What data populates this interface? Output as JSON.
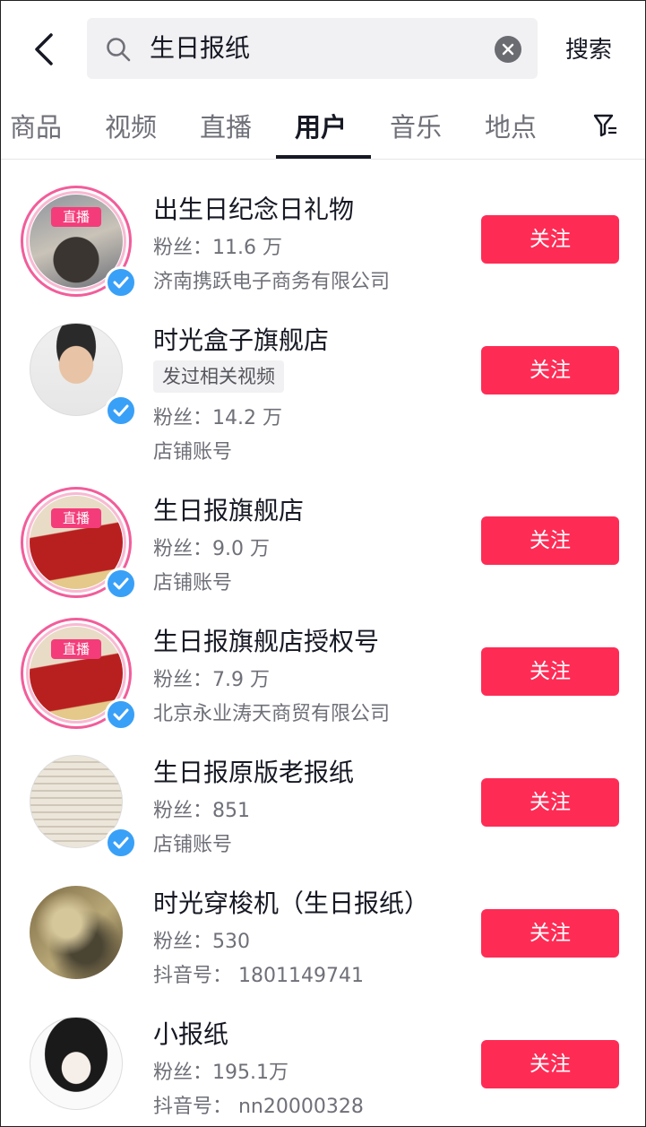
{
  "search": {
    "query": "生日报纸",
    "button_label": "搜索"
  },
  "tabs": [
    {
      "label": "商品",
      "active": false
    },
    {
      "label": "视频",
      "active": false
    },
    {
      "label": "直播",
      "active": false
    },
    {
      "label": "用户",
      "active": true
    },
    {
      "label": "音乐",
      "active": false
    },
    {
      "label": "地点",
      "active": false
    }
  ],
  "live_badge": "直播",
  "follow_label": "关注",
  "users": [
    {
      "name": "出生日纪念日礼物",
      "fans": "粉丝：11.6 万",
      "extra": "济南携跃电子商务有限公司",
      "live": true,
      "verified": true
    },
    {
      "name": "时光盒子旗舰店",
      "tag": "发过相关视频",
      "fans": "粉丝：14.2 万",
      "extra": "店铺账号",
      "live": false,
      "verified": true
    },
    {
      "name": "生日报旗舰店",
      "fans": "粉丝：9.0 万",
      "extra": "店铺账号",
      "live": true,
      "verified": true
    },
    {
      "name": "生日报旗舰店授权号",
      "fans": "粉丝：7.9 万",
      "extra": "北京永业涛天商贸有限公司",
      "live": true,
      "verified": true
    },
    {
      "name": "生日报原版老报纸",
      "fans": "粉丝：851",
      "extra": "店铺账号",
      "live": false,
      "verified": true
    },
    {
      "name": "时光穿梭机（生日报纸）",
      "fans": "粉丝：530",
      "extra": "抖音号： 1801149741",
      "live": false,
      "verified": false
    },
    {
      "name": "小报纸",
      "fans": "粉丝：195.1万",
      "extra": "抖音号： nn20000328",
      "live": false,
      "verified": false
    }
  ],
  "colors": {
    "follow": "#fe2c55",
    "verified": "#39a0f8",
    "live": "#f43c7b"
  }
}
